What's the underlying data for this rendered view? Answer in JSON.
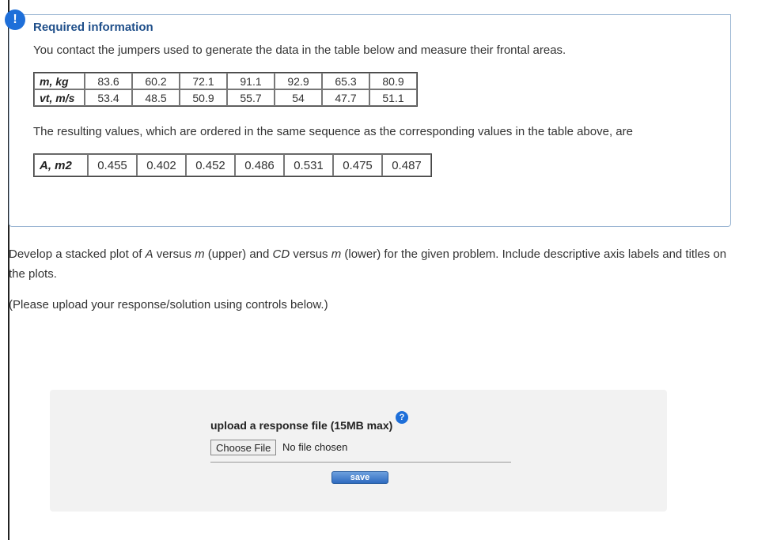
{
  "alert": {
    "symbol": "!"
  },
  "info": {
    "title": "Required information",
    "intro": "You contact the jumpers used to generate the data in the table below and measure their frontal areas.",
    "table1": {
      "row1_header": "m, kg",
      "row1": [
        "83.6",
        "60.2",
        "72.1",
        "91.1",
        "92.9",
        "65.3",
        "80.9"
      ],
      "row2_header": "vt, m/s",
      "row2": [
        "53.4",
        "48.5",
        "50.9",
        "55.7",
        "54",
        "47.7",
        "51.1"
      ]
    },
    "result_text": "The resulting values, which are ordered in the same sequence as the corresponding values in the table above, are",
    "table2": {
      "header": "A, m2",
      "values": [
        "0.455",
        "0.402",
        "0.452",
        "0.486",
        "0.531",
        "0.475",
        "0.487"
      ]
    }
  },
  "question": {
    "text_part1": "Develop a stacked plot of ",
    "var_a": "A",
    "text_part2": " versus ",
    "var_m1": "m",
    "text_part3": " (upper) and ",
    "var_cd": "CD",
    "text_part4": " versus ",
    "var_m2": "m",
    "text_part5": " (lower) for the given problem. Include descriptive axis labels and titles on the plots."
  },
  "upload_note": "(Please upload your response/solution using controls below.)",
  "upload": {
    "label": "upload a response file (15MB max)",
    "help_symbol": "?",
    "choose_button": "Choose File",
    "no_file": "No file chosen",
    "save_button": "save"
  }
}
